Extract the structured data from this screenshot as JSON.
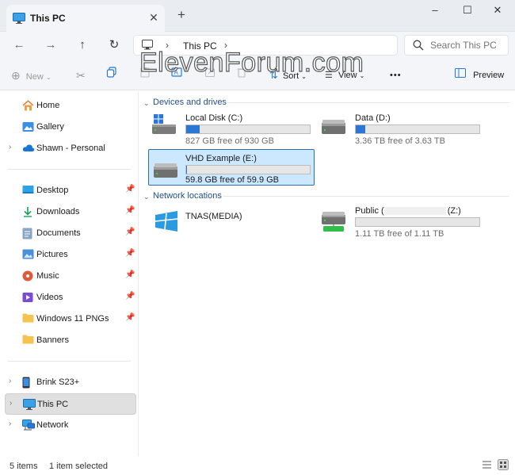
{
  "window": {
    "tab_title": "This PC",
    "new_tab": "+",
    "close_tab": "✕"
  },
  "address": {
    "current": "This PC",
    "search_placeholder": "Search This PC"
  },
  "toolbar": {
    "new_label": "New",
    "sort_label": "Sort",
    "view_label": "View",
    "more_label": "•••",
    "preview_label": "Preview"
  },
  "watermark": "ElevenForum.com",
  "sidebar": {
    "top": [
      {
        "label": "Home"
      },
      {
        "label": "Gallery"
      },
      {
        "label": "Shawn - Personal"
      }
    ],
    "quick": [
      {
        "label": "Desktop"
      },
      {
        "label": "Downloads"
      },
      {
        "label": "Documents"
      },
      {
        "label": "Pictures"
      },
      {
        "label": "Music"
      },
      {
        "label": "Videos"
      },
      {
        "label": "Windows 11 PNGs"
      },
      {
        "label": "Banners"
      }
    ],
    "bottom": [
      {
        "label": "Brink S23+"
      },
      {
        "label": "This PC"
      },
      {
        "label": "Network"
      }
    ]
  },
  "main": {
    "devices_header": "Devices and drives",
    "network_header": "Network locations",
    "drives": [
      {
        "name": "Local Disk (C:)",
        "free_text": "827 GB free of 930 GB",
        "used_fraction": 0.11
      },
      {
        "name": "Data (D:)",
        "free_text": "3.36 TB free of 3.63 TB",
        "used_fraction": 0.074
      },
      {
        "name": "VHD Example (E:)",
        "free_text": "59.8 GB free of 59.9 GB",
        "used_fraction": 0.002
      }
    ],
    "network": [
      {
        "name": "TNAS(MEDIA)"
      },
      {
        "name_prefix": "Public (",
        "name_suffix": "(Z:)",
        "free_text": "1.11 TB free of 1.11 TB",
        "used_fraction": 0.0
      }
    ]
  },
  "status": {
    "count": "5 items",
    "selected": "1 item selected"
  },
  "colors": {
    "accent": "#2b78d4",
    "selection_bg": "#cce8ff",
    "selection_border": "#2c6fb6",
    "header_blue": "#1f4e8c"
  }
}
